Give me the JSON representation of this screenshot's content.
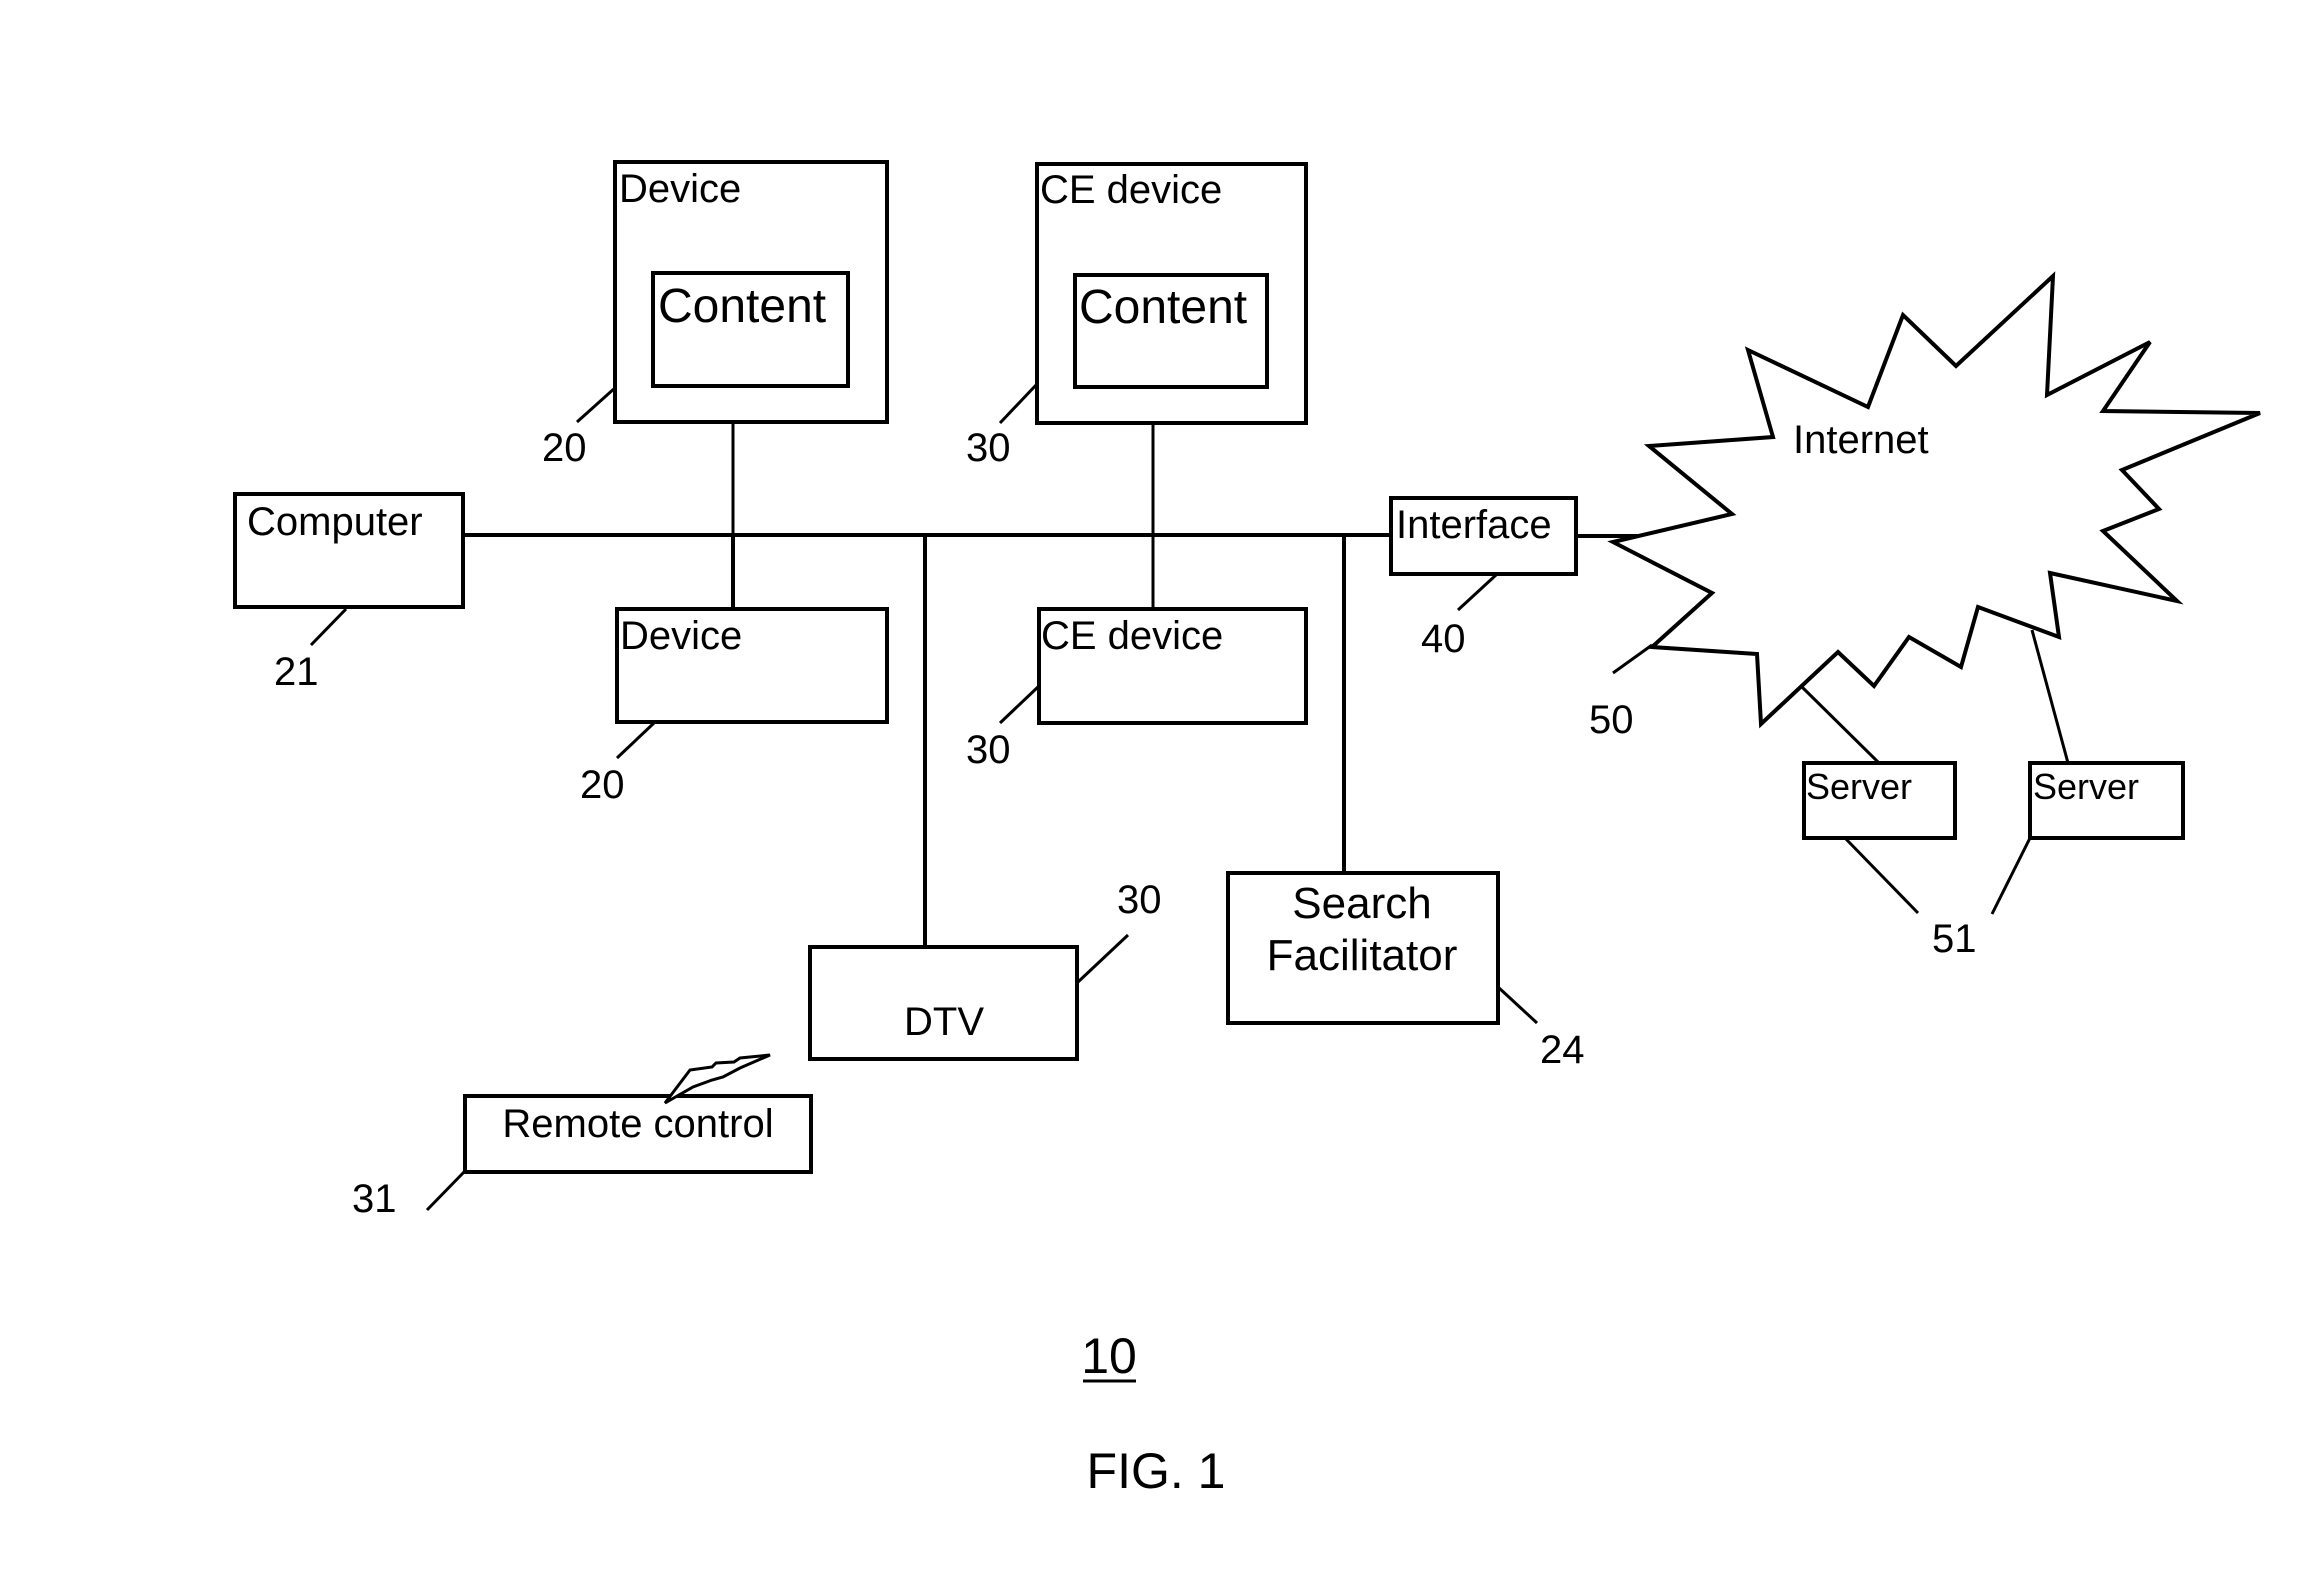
{
  "figure": {
    "title": "FIG. 1",
    "system_ref": "10"
  },
  "nodes": {
    "device_top": {
      "label": "Device",
      "inner_label": "Content",
      "ref": "20"
    },
    "ce_device_top": {
      "label": "CE device",
      "inner_label": "Content",
      "ref": "30"
    },
    "computer": {
      "label": "Computer",
      "ref": "21"
    },
    "device_bottom": {
      "label": "Device",
      "ref": "20"
    },
    "ce_device_bottom": {
      "label": "CE device",
      "ref": "30"
    },
    "interface": {
      "label": "Interface",
      "ref": "40"
    },
    "internet": {
      "label": "Internet",
      "ref": "50"
    },
    "server_left": {
      "label": "Server"
    },
    "server_right": {
      "label": "Server"
    },
    "servers_ref": "51",
    "dtv": {
      "label": "DTV",
      "ref": "30"
    },
    "remote_control": {
      "label": "Remote control",
      "ref": "31"
    },
    "search_facilitator": {
      "label_line1": "Search",
      "label_line2": "Facilitator",
      "ref": "24"
    }
  },
  "colors": {
    "stroke": "#000000",
    "background": "#ffffff"
  }
}
